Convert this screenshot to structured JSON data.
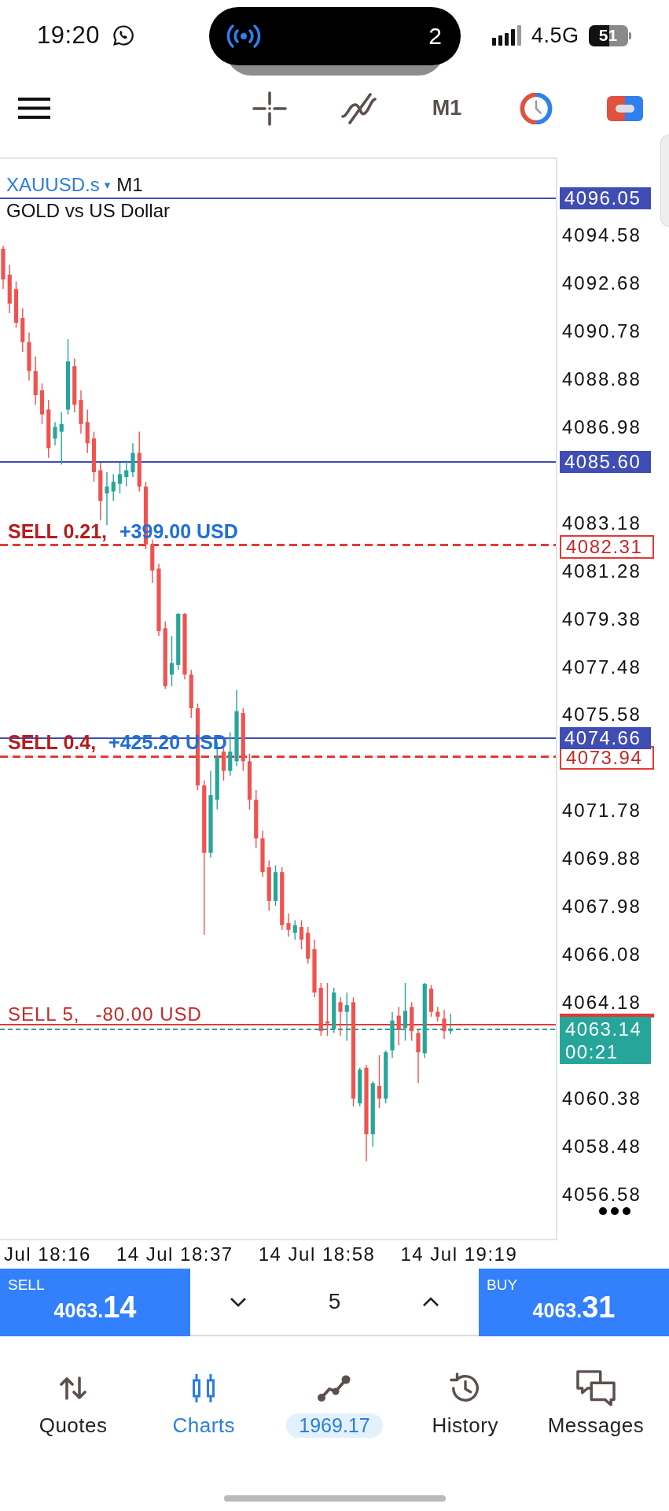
{
  "status_bar": {
    "time": "19:20",
    "island_count": "2",
    "network": "4.5G",
    "battery": "51"
  },
  "toolbar": {
    "timeframe": "M1"
  },
  "chart": {
    "symbol": "XAUUSD.s",
    "symbol_caret": "▾",
    "timeframe": "M1",
    "description": "GOLD vs US Dollar",
    "price_axis": [
      "4094.58",
      "4092.68",
      "4090.78",
      "4088.88",
      "4086.98",
      "4083.18",
      "4081.28",
      "4079.38",
      "4077.48",
      "4075.58",
      "4071.78",
      "4069.88",
      "4067.98",
      "4066.08",
      "4064.18",
      "4060.38",
      "4058.48",
      "4056.58"
    ],
    "levels": [
      {
        "price": "4096.05"
      },
      {
        "price": "4085.60"
      },
      {
        "price": "4074.66"
      }
    ],
    "orders": [
      {
        "kind": "dashed",
        "label": "SELL 0.21,",
        "profit": "+399.00 USD",
        "color": "#1f6fd8",
        "price": "4082.31"
      },
      {
        "kind": "dashed",
        "label": "SELL 0.4,",
        "profit": "+425.20 USD",
        "color": "#1f6fd8",
        "price": "4073.94"
      },
      {
        "kind": "solid",
        "label": "SELL 5,",
        "profit": "-80.00 USD",
        "color": "#c62828"
      }
    ],
    "bid": {
      "price": "4063.14",
      "countdown": "00:21"
    },
    "time_axis": [
      "Jul 18:16",
      "14 Jul 18:37",
      "14 Jul 18:58",
      "14 Jul 19:19"
    ]
  },
  "trade_bar": {
    "sell": {
      "label": "SELL",
      "price_head": "4063.",
      "price_tail": "14"
    },
    "volume": "5",
    "buy": {
      "label": "BUY",
      "price_head": "4063.",
      "price_tail": "31"
    }
  },
  "bottom_nav": [
    {
      "kind": "quotes",
      "label": "Quotes",
      "selected": false
    },
    {
      "kind": "charts",
      "label": "Charts",
      "selected": true
    },
    {
      "kind": "trade",
      "label": "1969.17",
      "selected": false
    },
    {
      "kind": "history",
      "label": "History",
      "selected": false
    },
    {
      "kind": "messages",
      "label": "Messages",
      "selected": false
    }
  ]
}
